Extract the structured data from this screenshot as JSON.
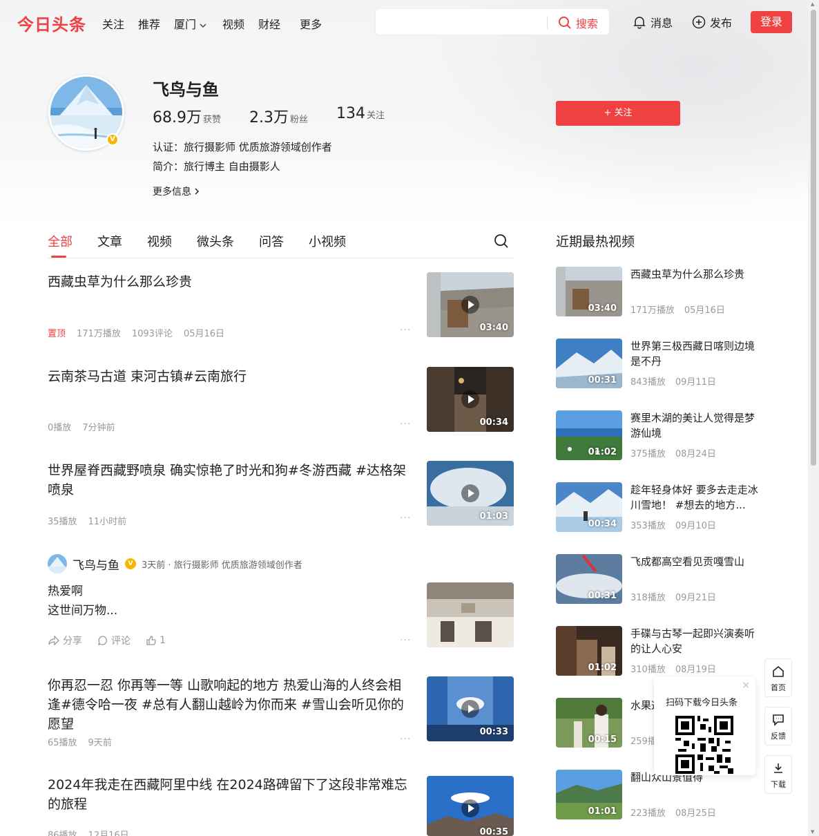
{
  "app": {
    "logo": "今日头条",
    "nav": [
      "关注",
      "推荐",
      "厦门",
      "视频",
      "财经",
      "更多"
    ],
    "search": {
      "placeholder": "",
      "button": "搜索"
    },
    "messages": "消息",
    "publish": "发布",
    "login": "登录",
    "accent": "#f04142"
  },
  "profile": {
    "name": "飞鸟与鱼",
    "stats": [
      {
        "value": "68.9万",
        "label": "获赞"
      },
      {
        "value": "2.3万",
        "label": "粉丝"
      },
      {
        "value": "134",
        "label": "关注"
      }
    ],
    "cert": "认证：旅行摄影师 优质旅游领域创作者",
    "bio": "简介：旅行博主 自由摄影人",
    "more": "更多信息",
    "follow": "+ 关注"
  },
  "tabs": [
    "全部",
    "文章",
    "视频",
    "微头条",
    "问答",
    "小视频"
  ],
  "feed": [
    {
      "title": "西藏虫草为什么那么珍贵",
      "pin": "置顶",
      "meta": [
        "171万播放",
        "1093评论",
        "05月16日"
      ],
      "duration": "03:40"
    },
    {
      "title": "云南茶马古道 束河古镇#云南旅行",
      "meta": [
        "0播放",
        "7分钟前"
      ],
      "duration": "00:34"
    },
    {
      "title": "世界屋脊西藏野喷泉 确实惊艳了时光和狗#冬游西藏 #达格架喷泉",
      "meta": [
        "35播放",
        "11小时前"
      ],
      "duration": "01:03"
    },
    {
      "title": "你再忍一忍 你再等一等 山歌响起的地方 热爱山海的人终会相逢#德令哈一夜 #总有人翻山越岭为你而来 #雪山会听见你的愿望",
      "meta": [
        "65播放",
        "9天前"
      ],
      "duration": "00:33"
    },
    {
      "title": "2024年我走在西藏阿里中线 在2024路碑留下了这段非常难忘的旅程",
      "meta": [
        "86播放",
        "12月16日"
      ],
      "duration": "00:35"
    }
  ],
  "micro": {
    "name": "飞鸟与鱼",
    "sub": "3天前 · 旅行摄影师 优质旅游领域创作者",
    "line1": "热爱啊",
    "line2": "这世间万物...",
    "share": "分享",
    "comment": "评论",
    "likes": "1"
  },
  "sidebar": {
    "title": "近期最热视频",
    "items": [
      {
        "title": "西藏虫草为什么那么珍贵",
        "plays": "171万播放",
        "date": "05月16日",
        "duration": "03:40"
      },
      {
        "title": "世界第三极西藏日喀则边境是不丹",
        "plays": "843播放",
        "date": "09月11日",
        "duration": "00:31"
      },
      {
        "title": "赛里木湖的美让人觉得是梦游仙境",
        "plays": "375播放",
        "date": "08月24日",
        "duration": "01:02"
      },
      {
        "title": "趁年轻身体好 要多去走走冰川雪地！ #想去的地方...",
        "plays": "353播放",
        "date": "09月10日",
        "duration": "00:34"
      },
      {
        "title": "飞成都高空看见贡嘎雪山",
        "plays": "318播放",
        "date": "09月21日",
        "duration": "00:31"
      },
      {
        "title": "手碟与古琴一起即兴演奏听的让人心安",
        "plays": "310播放",
        "date": "08月19日",
        "duration": "01:02"
      },
      {
        "title": "水果这个",
        "plays": "259播",
        "date": "",
        "duration": "00:15"
      },
      {
        "title": "翻山众山景值得",
        "plays": "223播放",
        "date": "08月25日",
        "duration": "01:01"
      }
    ]
  },
  "tools": {
    "home": "首页",
    "feedback": "反馈",
    "download": "下载"
  },
  "qr": {
    "title": "扫码下载今日头条",
    "close": "×"
  }
}
